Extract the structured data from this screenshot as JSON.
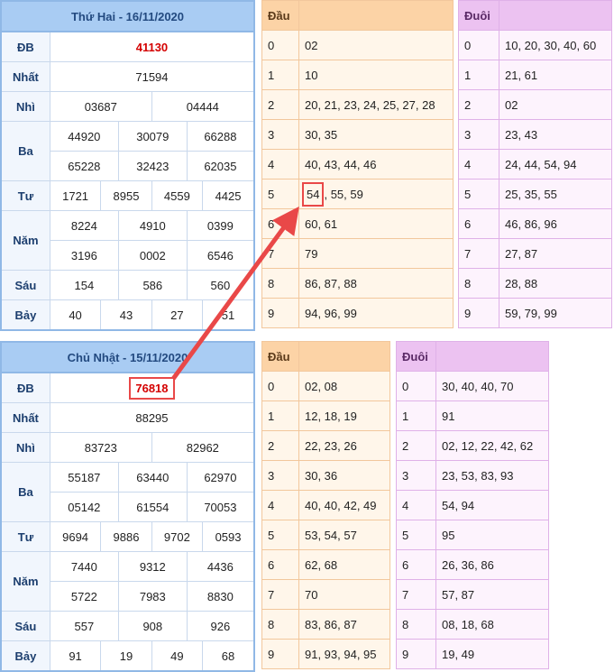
{
  "monday": {
    "title": "Thứ Hai - 16/11/2020",
    "rows": [
      {
        "label": "ĐB",
        "values": [
          "41130"
        ]
      },
      {
        "label": "Nhất",
        "values": [
          "71594"
        ]
      },
      {
        "label": "Nhì",
        "values": [
          "03687",
          "04444"
        ]
      },
      {
        "label": "Ba",
        "values": [
          "44920",
          "30079",
          "66288",
          "65228",
          "32423",
          "62035"
        ]
      },
      {
        "label": "Tư",
        "values": [
          "1721",
          "8955",
          "4559",
          "4425"
        ]
      },
      {
        "label": "Năm",
        "values": [
          "8224",
          "4910",
          "0399",
          "3196",
          "0002",
          "6546"
        ]
      },
      {
        "label": "Sáu",
        "values": [
          "154",
          "586",
          "560"
        ]
      },
      {
        "label": "Bảy",
        "values": [
          "40",
          "43",
          "27",
          "51"
        ]
      }
    ],
    "dau_header": "Đầu",
    "dau": [
      {
        "d": "0",
        "v": "02"
      },
      {
        "d": "1",
        "v": "10"
      },
      {
        "d": "2",
        "v": "20, 21, 23, 24, 25, 27, 28"
      },
      {
        "d": "3",
        "v": "30, 35"
      },
      {
        "d": "4",
        "v": "40, 43, 44, 46"
      },
      {
        "d": "5",
        "v_hl": "54",
        "v_rest": ", 55, 59"
      },
      {
        "d": "6",
        "v": "60, 61"
      },
      {
        "d": "7",
        "v": "79"
      },
      {
        "d": "8",
        "v": "86, 87, 88"
      },
      {
        "d": "9",
        "v": "94, 96, 99"
      }
    ],
    "duoi_header": "Đuôi",
    "duoi": [
      {
        "d": "0",
        "v": "10, 20, 30, 40, 60"
      },
      {
        "d": "1",
        "v": "21, 61"
      },
      {
        "d": "2",
        "v": "02"
      },
      {
        "d": "3",
        "v": "23, 43"
      },
      {
        "d": "4",
        "v": "24, 44, 54, 94"
      },
      {
        "d": "5",
        "v": "25, 35, 55"
      },
      {
        "d": "6",
        "v": "46, 86, 96"
      },
      {
        "d": "7",
        "v": "27, 87"
      },
      {
        "d": "8",
        "v": "28, 88"
      },
      {
        "d": "9",
        "v": "59, 79, 99"
      }
    ]
  },
  "sunday": {
    "title": "Chủ Nhật - 15/11/2020",
    "rows": [
      {
        "label": "ĐB",
        "values": [
          "76818"
        ]
      },
      {
        "label": "Nhất",
        "values": [
          "88295"
        ]
      },
      {
        "label": "Nhì",
        "values": [
          "83723",
          "82962"
        ]
      },
      {
        "label": "Ba",
        "values": [
          "55187",
          "63440",
          "62970",
          "05142",
          "61554",
          "70053"
        ]
      },
      {
        "label": "Tư",
        "values": [
          "9694",
          "9886",
          "9702",
          "0593"
        ]
      },
      {
        "label": "Năm",
        "values": [
          "7440",
          "9312",
          "4436",
          "5722",
          "7983",
          "8830"
        ]
      },
      {
        "label": "Sáu",
        "values": [
          "557",
          "908",
          "926"
        ]
      },
      {
        "label": "Bảy",
        "values": [
          "91",
          "19",
          "49",
          "68"
        ]
      }
    ],
    "dau_header": "Đầu",
    "dau": [
      {
        "d": "0",
        "v": "02, 08"
      },
      {
        "d": "1",
        "v": "12, 18, 19"
      },
      {
        "d": "2",
        "v": "22, 23, 26"
      },
      {
        "d": "3",
        "v": "30, 36"
      },
      {
        "d": "4",
        "v": "40, 40, 42, 49"
      },
      {
        "d": "5",
        "v": "53, 54, 57"
      },
      {
        "d": "6",
        "v": "62, 68"
      },
      {
        "d": "7",
        "v": "70"
      },
      {
        "d": "8",
        "v": "83, 86, 87"
      },
      {
        "d": "9",
        "v": "91, 93, 94, 95"
      }
    ],
    "duoi_header": "Đuôi",
    "duoi": [
      {
        "d": "0",
        "v": "30, 40, 40, 70"
      },
      {
        "d": "1",
        "v": "91"
      },
      {
        "d": "2",
        "v": "02, 12, 22, 42, 62"
      },
      {
        "d": "3",
        "v": "23, 53, 83, 93"
      },
      {
        "d": "4",
        "v": "54, 94"
      },
      {
        "d": "5",
        "v": "95"
      },
      {
        "d": "6",
        "v": "26, 36, 86"
      },
      {
        "d": "7",
        "v": "57, 87"
      },
      {
        "d": "8",
        "v": "08, 18, 68"
      },
      {
        "d": "9",
        "v": "19, 49"
      }
    ]
  },
  "colors": {
    "highlight": "#e94848",
    "special_prize": "#d40000"
  }
}
